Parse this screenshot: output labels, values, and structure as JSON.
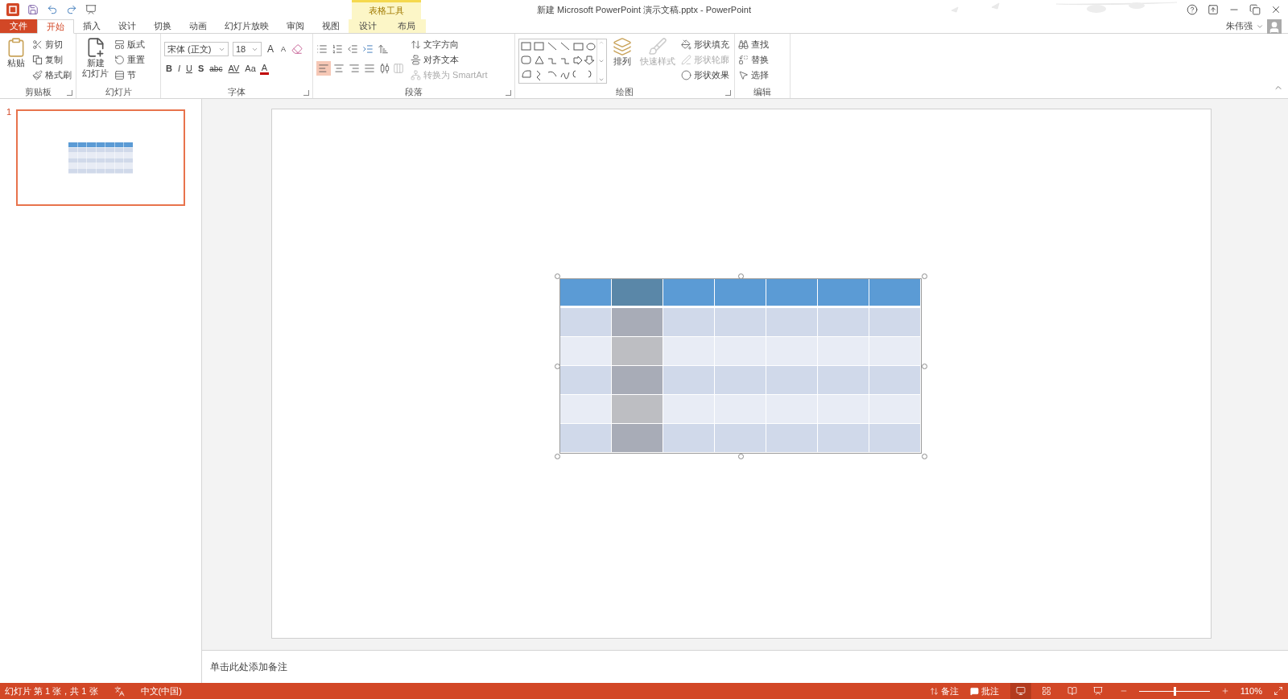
{
  "title_bar": {
    "title": "新建 Microsoft PowerPoint 演示文稿.pptx - PowerPoint",
    "context_label": "表格工具"
  },
  "tabs": [
    {
      "label": "文件",
      "kind": "file",
      "selected": false
    },
    {
      "label": "开始",
      "kind": "normal",
      "selected": true
    },
    {
      "label": "插入",
      "kind": "normal",
      "selected": false
    },
    {
      "label": "设计",
      "kind": "normal",
      "selected": false
    },
    {
      "label": "切换",
      "kind": "normal",
      "selected": false
    },
    {
      "label": "动画",
      "kind": "normal",
      "selected": false
    },
    {
      "label": "幻灯片放映",
      "kind": "normal",
      "selected": false
    },
    {
      "label": "审阅",
      "kind": "normal",
      "selected": false
    },
    {
      "label": "视图",
      "kind": "normal",
      "selected": false
    },
    {
      "label": "设计",
      "kind": "context",
      "selected": false
    },
    {
      "label": "布局",
      "kind": "context",
      "selected": false
    }
  ],
  "user": {
    "name": "朱伟强"
  },
  "ribbon": {
    "clipboard": {
      "label": "剪贴板",
      "paste": "粘贴",
      "items": [
        {
          "label": "剪切",
          "kind": "cut"
        },
        {
          "label": "复制",
          "kind": "copy"
        },
        {
          "label": "格式刷",
          "kind": "brush"
        }
      ]
    },
    "slides": {
      "label": "幻灯片",
      "new_slide": [
        "新建",
        "幻灯片"
      ],
      "items": [
        {
          "label": "版式",
          "kind": "layout"
        },
        {
          "label": "重置",
          "kind": "reset"
        },
        {
          "label": "节",
          "kind": "section"
        }
      ]
    },
    "font": {
      "label": "字体",
      "font_name": "宋体 (正文)",
      "font_size": "18",
      "grow": "A",
      "shrink": "A",
      "buttons": [
        {
          "label": "B",
          "kind": "bold"
        },
        {
          "label": "I",
          "kind": "italic"
        },
        {
          "label": "U",
          "kind": "underline"
        },
        {
          "label": "S",
          "kind": "shadow"
        },
        {
          "label": "abc",
          "kind": "strike"
        },
        {
          "label": "AV",
          "kind": "spacing"
        },
        {
          "label": "Aa",
          "kind": "case"
        },
        {
          "label": "A",
          "kind": "color"
        }
      ]
    },
    "paragraph": {
      "label": "段落",
      "align": [
        {
          "kind": "left",
          "selected": true
        },
        {
          "kind": "center",
          "selected": false
        },
        {
          "kind": "right",
          "selected": false
        },
        {
          "kind": "justify",
          "selected": false
        },
        {
          "kind": "distributed",
          "selected": false
        }
      ],
      "items": [
        {
          "label": "文字方向",
          "kind": "direction",
          "disabled": false
        },
        {
          "label": "对齐文本",
          "kind": "align",
          "disabled": false
        },
        {
          "label": "转换为 SmartArt",
          "kind": "smartart",
          "disabled": true
        }
      ]
    },
    "drawing": {
      "label": "绘图",
      "large": [
        {
          "label": "排列",
          "kind": "arrange",
          "disabled": false
        },
        {
          "label": "快速样式",
          "kind": "styles",
          "disabled": true
        }
      ],
      "items": [
        {
          "label": "形状填充",
          "kind": "fill",
          "disabled": false
        },
        {
          "label": "形状轮廓",
          "kind": "outline",
          "disabled": true
        },
        {
          "label": "形状效果",
          "kind": "effects",
          "disabled": false
        }
      ]
    },
    "editing": {
      "label": "编辑",
      "items": [
        {
          "label": "查找",
          "kind": "find"
        },
        {
          "label": "替换",
          "kind": "replace"
        },
        {
          "label": "选择",
          "kind": "select"
        }
      ]
    }
  },
  "thumbnails": [
    {
      "number": "1",
      "selected": true
    }
  ],
  "slide": {
    "table": {
      "columns": [
        {
          "selected": false
        },
        {
          "selected": true
        },
        {
          "selected": false
        },
        {
          "selected": false
        },
        {
          "selected": false
        },
        {
          "selected": false
        },
        {
          "selected": false
        }
      ],
      "rows": [
        {
          "kind": "header"
        },
        {
          "kind": "band"
        },
        {
          "kind": "plain"
        },
        {
          "kind": "band"
        },
        {
          "kind": "plain"
        },
        {
          "kind": "band"
        }
      ]
    }
  },
  "notes": {
    "placeholder": "单击此处添加备注"
  },
  "status_bar": {
    "slide_info": "幻灯片 第 1 张，共 1 张",
    "language": "中文(中国)",
    "notes": "备注",
    "comments": "批注",
    "views": [
      {
        "kind": "normal",
        "selected": true
      },
      {
        "kind": "sorter",
        "selected": false
      },
      {
        "kind": "reading",
        "selected": false
      },
      {
        "kind": "show",
        "selected": false
      }
    ],
    "zoom": {
      "level": 0.5,
      "reading": "110%"
    }
  }
}
